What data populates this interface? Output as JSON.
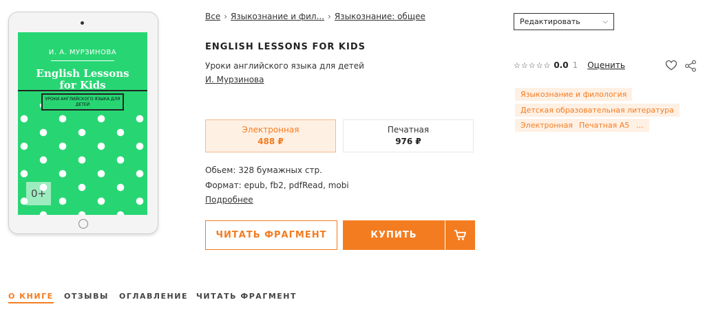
{
  "breadcrumb": {
    "items": [
      "Все",
      "Языкознание и фил...",
      "Языкознание: общее"
    ]
  },
  "cover": {
    "author": "И. А. МУРЗИНОВА",
    "title_line1": "English Lessons",
    "title_line2": "for Kids",
    "subtitle": "УРОКИ АНГЛИЙСКОГО ЯЗЫКА ДЛЯ ДЕТЕЙ",
    "age": "0+",
    "color": "#27d673"
  },
  "book": {
    "title": "ENGLISH LESSONS FOR KIDS",
    "subtitle": "Уроки английского языка для детей",
    "author": "И. Мурзинова"
  },
  "formats": [
    {
      "name": "Электронная",
      "price": "488 ₽",
      "active": true
    },
    {
      "name": "Печатная",
      "price": "976 ₽",
      "active": false
    }
  ],
  "meta": {
    "volume": "Обьем: 328 бумажных стр.",
    "format": "Формат: epub, fb2, pdfRead, mobi",
    "more": "Подробнее"
  },
  "actions": {
    "read_fragment": "ЧИТАТЬ ФРАГМЕНТ",
    "buy": "КУПИТЬ",
    "cart_icon": "cart-icon"
  },
  "edit_select": {
    "value": "Редактировать"
  },
  "rating": {
    "stars": "☆☆☆☆☆",
    "value": "0.0",
    "count": "1",
    "rate_label": "Оценить"
  },
  "tags": [
    "Языкознание и филология",
    "Детская образовательная литература",
    "Электронная",
    "Печатная А5",
    "..."
  ],
  "tabs": [
    "О КНИГЕ",
    "ОТЗЫВЫ",
    "ОГЛАВЛЕНИЕ",
    "ЧИТАТЬ ФРАГМЕНТ"
  ],
  "colors": {
    "accent": "#f47c20",
    "accent_light": "#fff0e4"
  }
}
